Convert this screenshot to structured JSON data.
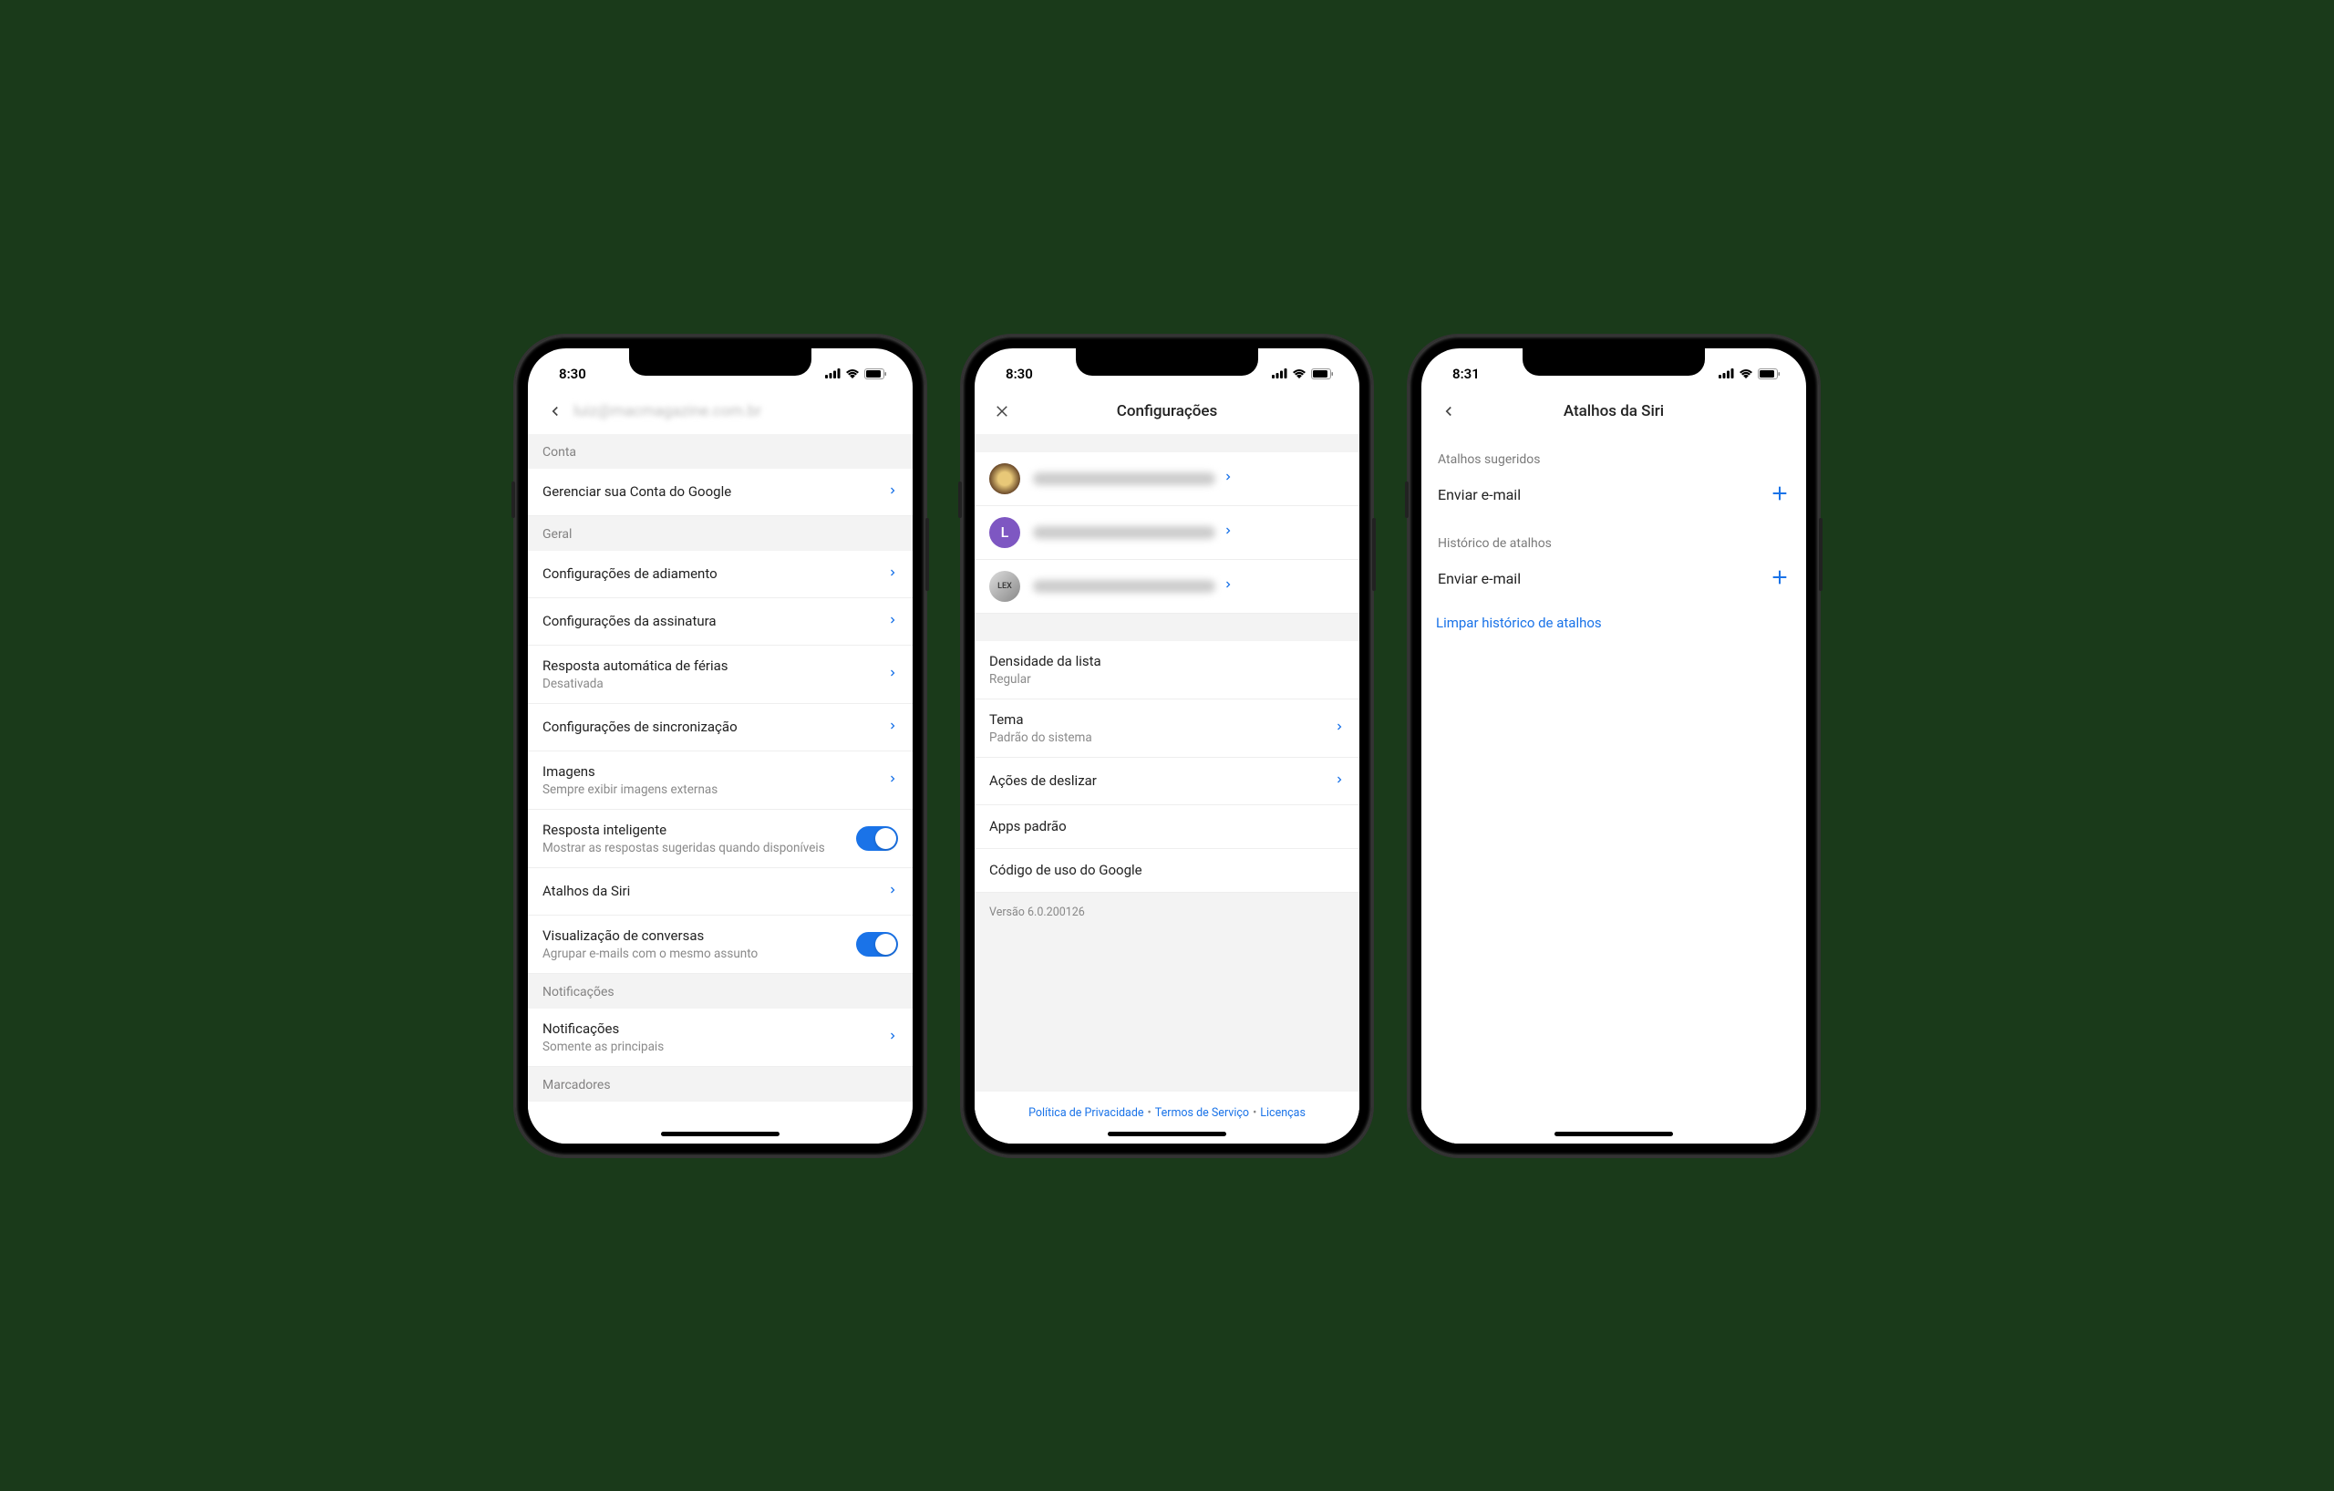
{
  "colors": {
    "accent": "#1a73e8"
  },
  "status": {
    "time1": "8:30",
    "time2": "8:30",
    "time3": "8:31"
  },
  "screen1": {
    "title_blurred": "luiz@macmagazine.com.br",
    "sections": {
      "conta": "Conta",
      "geral": "Geral",
      "notificacoes": "Notificações",
      "marcadores": "Marcadores"
    },
    "rows": {
      "manage": "Gerenciar sua Conta do Google",
      "snooze": "Configurações de adiamento",
      "signature": "Configurações da assinatura",
      "vacation": "Resposta automática de férias",
      "vacation_sub": "Desativada",
      "sync": "Configurações de sincronização",
      "images": "Imagens",
      "images_sub": "Sempre exibir imagens externas",
      "smartreply": "Resposta inteligente",
      "smartreply_sub": "Mostrar as respostas sugeridas quando disponíveis",
      "siri": "Atalhos da Siri",
      "conversation": "Visualização de conversas",
      "conversation_sub": "Agrupar e-mails com o mesmo assunto",
      "notif": "Notificações",
      "notif_sub": "Somente as principais"
    }
  },
  "screen2": {
    "title": "Configurações",
    "accounts": [
      {
        "letter": "",
        "email": "——————@———.com"
      },
      {
        "letter": "L",
        "email": "————@————————.com.br"
      },
      {
        "letter": "",
        "email": "——————@———.com"
      }
    ],
    "rows": {
      "density": "Densidade da lista",
      "density_sub": "Regular",
      "theme": "Tema",
      "theme_sub": "Padrão do sistema",
      "swipe": "Ações de deslizar",
      "default_apps": "Apps padrão",
      "google_code": "Código de uso do Google"
    },
    "version": "Versão 6.0.200126",
    "footer": {
      "privacy": "Política de Privacidade",
      "terms": "Termos de Serviço",
      "licenses": "Licenças"
    }
  },
  "screen3": {
    "title": "Atalhos da Siri",
    "suggested_label": "Atalhos sugeridos",
    "suggested_item": "Enviar e-mail",
    "history_label": "Histórico de atalhos",
    "history_item": "Enviar e-mail",
    "clear": "Limpar histórico de atalhos"
  }
}
